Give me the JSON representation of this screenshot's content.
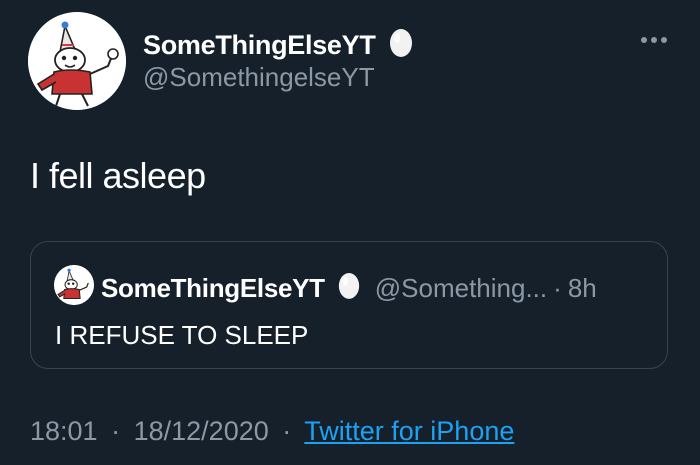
{
  "tweet": {
    "author": {
      "display_name": "SomeThingElseYT",
      "handle": "@SomethingelseYT",
      "avatar_icon": "cartoon-character-avatar",
      "badge_icon": "egg-icon"
    },
    "text": "I fell asleep",
    "more_icon": "more-options-icon"
  },
  "quoted_tweet": {
    "display_name": "SomeThingElseYT",
    "handle": "@Something...",
    "separator": "·",
    "time": "8h",
    "text": "I REFUSE TO SLEEP"
  },
  "meta": {
    "time": "18:01",
    "date": "18/12/2020",
    "separator": "·",
    "source": "Twitter for iPhone"
  },
  "colors": {
    "background": "#15202b",
    "text": "#ffffff",
    "secondary_text": "#8b98a5",
    "link": "#1da1f2",
    "border": "#38444d"
  }
}
